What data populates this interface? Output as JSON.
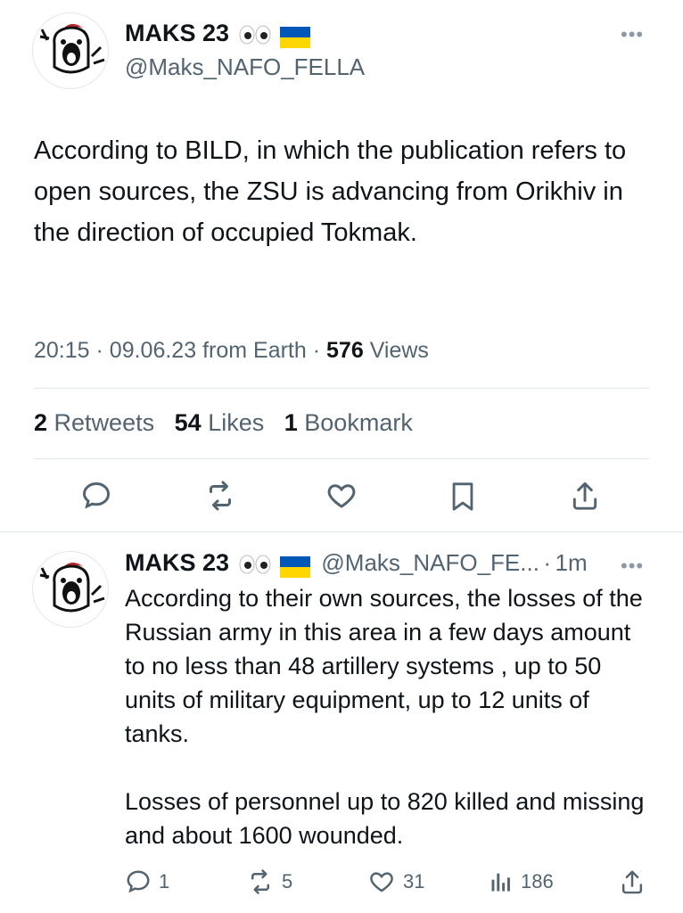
{
  "main_tweet": {
    "author_name": "MAKS 23",
    "author_handle": "@Maks_NAFO_FELLA",
    "text": "According to BILD, in which the publication refers to open sources, the ZSU is advancing from Orikhiv in the direction of occupied Tokmak.",
    "time": "20:15",
    "date": "09.06.23",
    "source": "from Earth",
    "views_count": "576",
    "views_label": "Views",
    "retweets_count": "2",
    "retweets_label": "Retweets",
    "likes_count": "54",
    "likes_label": "Likes",
    "bookmarks_count": "1",
    "bookmarks_label": "Bookmark",
    "more_label": "•••"
  },
  "reply_tweet": {
    "author_name": "MAKS 23",
    "author_handle": "@Maks_NAFO_FE...",
    "time_ago": "1m",
    "more_label": "•••",
    "text": "According to their own sources, the losses of the Russian army in this area in a few days amount to no less than 48 artillery systems , up to 50 units of military equipment, up to 12 units of tanks.\n\n Losses of personnel up to 820 killed and missing and about 1600 wounded.",
    "replies": "1",
    "retweets": "5",
    "likes": "31",
    "views": "186"
  },
  "separators": {
    "dot": "·"
  },
  "colors": {
    "text": "#0f1419",
    "secondary": "#536471",
    "divider": "#e1e8ed",
    "flag_blue": "#0057b7",
    "flag_yellow": "#ffd700"
  },
  "icons": [
    "reply-icon",
    "retweet-icon",
    "like-icon",
    "bookmark-icon",
    "share-icon",
    "views-icon",
    "more-icon",
    "eyes-emoji",
    "ukraine-flag"
  ]
}
